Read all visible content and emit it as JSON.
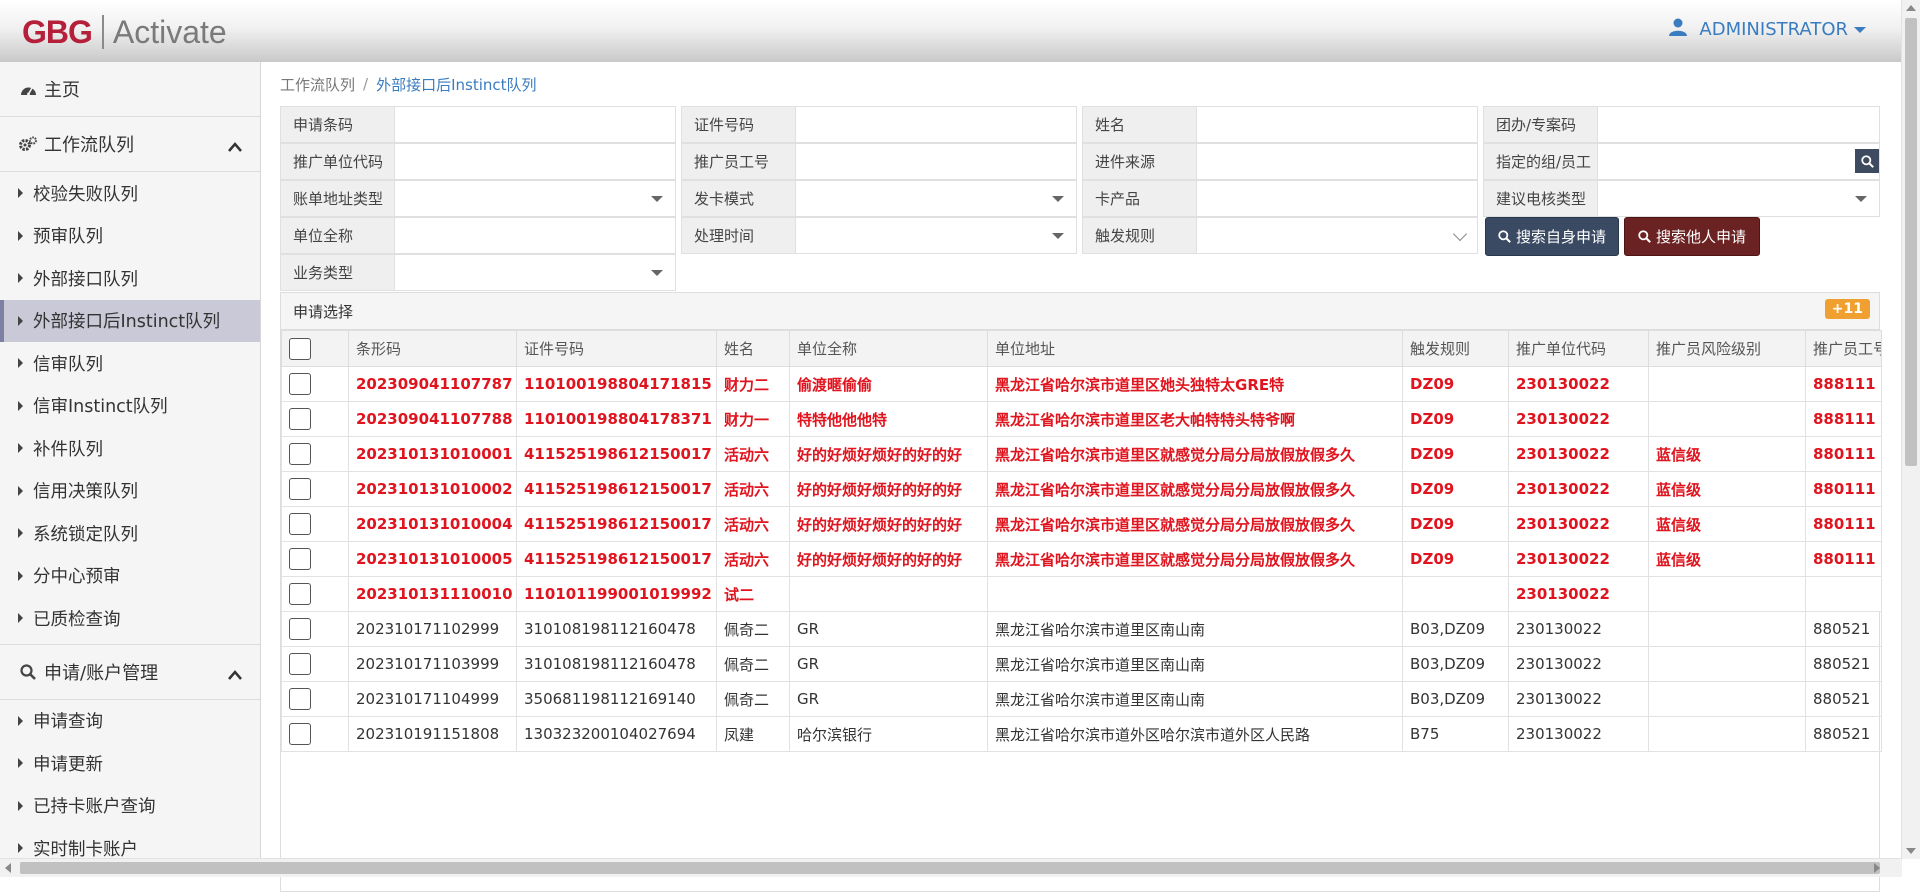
{
  "app": {
    "logo_left": "GBG",
    "logo_right": "Activate",
    "user": "ADMINISTRATOR"
  },
  "sidebar": {
    "home": "主页",
    "section1": "工作流队列",
    "items1": [
      "校验失败队列",
      "预审队列",
      "外部接口队列",
      "外部接口后Instinct队列",
      "信审队列",
      "信审Instinct队列",
      "补件队列",
      "信用决策队列",
      "系统锁定队列",
      "分中心预审",
      "已质检查询"
    ],
    "section2": "申请/账户管理",
    "items2": [
      "申请查询",
      "申请更新",
      "已持卡账户查询",
      "实时制卡账户"
    ]
  },
  "breadcrumb": {
    "parent": "工作流队列",
    "sep": "/",
    "current": "外部接口后Instinct队列"
  },
  "form": {
    "labels": [
      "申请条码",
      "证件号码",
      "姓名",
      "团办/专案码",
      "推广单位代码",
      "推广员工号",
      "进件来源",
      "指定的组/员工",
      "账单地址类型",
      "发卡模式",
      "卡产品",
      "建议电核类型",
      "单位全称",
      "处理时间",
      "触发规则",
      "业务类型"
    ],
    "btn_self": "搜索自身申请",
    "btn_other": "搜索他人申请"
  },
  "panel": {
    "title": "申请选择",
    "badge": "+11"
  },
  "table": {
    "headers": [
      "条形码",
      "证件号码",
      "姓名",
      "单位全称",
      "单位地址",
      "触发规则",
      "推广单位代码",
      "推广员风险级别",
      "推广员工号"
    ],
    "rows": [
      {
        "red": true,
        "cells": [
          "202309041107787",
          "110100198804171815",
          "财力二",
          "偷渡暱偷偷",
          "黑龙江省哈尔滨市道里区她头独特太GRE特",
          "DZ09",
          "230130022",
          "",
          "888111"
        ]
      },
      {
        "red": true,
        "cells": [
          "202309041107788",
          "110100198804178371",
          "财力一",
          "特特他他他特",
          "黑龙江省哈尔滨市道里区老大帕特特头特爷啊",
          "DZ09",
          "230130022",
          "",
          "888111"
        ]
      },
      {
        "red": true,
        "cells": [
          "202310131010001",
          "411525198612150017",
          "活动六",
          "好的好烦好烦好的好的好",
          "黑龙江省哈尔滨市道里区就感觉分局分局放假放假多久",
          "DZ09",
          "230130022",
          "蓝信级",
          "880111"
        ]
      },
      {
        "red": true,
        "cells": [
          "202310131010002",
          "411525198612150017",
          "活动六",
          "好的好烦好烦好的好的好",
          "黑龙江省哈尔滨市道里区就感觉分局分局放假放假多久",
          "DZ09",
          "230130022",
          "蓝信级",
          "880111"
        ]
      },
      {
        "red": true,
        "cells": [
          "202310131010004",
          "411525198612150017",
          "活动六",
          "好的好烦好烦好的好的好",
          "黑龙江省哈尔滨市道里区就感觉分局分局放假放假多久",
          "DZ09",
          "230130022",
          "蓝信级",
          "880111"
        ]
      },
      {
        "red": true,
        "cells": [
          "202310131010005",
          "411525198612150017",
          "活动六",
          "好的好烦好烦好的好的好",
          "黑龙江省哈尔滨市道里区就感觉分局分局放假放假多久",
          "DZ09",
          "230130022",
          "蓝信级",
          "880111"
        ]
      },
      {
        "red": true,
        "cells": [
          "202310131110010",
          "110101199001019992",
          "试二",
          "",
          "",
          "",
          "230130022",
          "",
          ""
        ]
      },
      {
        "red": false,
        "cells": [
          "202310171102999",
          "310108198112160478",
          "佩奇二",
          "GR",
          "黑龙江省哈尔滨市道里区南山南",
          "B03,DZ09",
          "230130022",
          "",
          "880521"
        ]
      },
      {
        "red": false,
        "cells": [
          "202310171103999",
          "310108198112160478",
          "佩奇二",
          "GR",
          "黑龙江省哈尔滨市道里区南山南",
          "B03,DZ09",
          "230130022",
          "",
          "880521"
        ]
      },
      {
        "red": false,
        "cells": [
          "202310171104999",
          "350681198112169140",
          "佩奇二",
          "GR",
          "黑龙江省哈尔滨市道里区南山南",
          "B03,DZ09",
          "230130022",
          "",
          "880521"
        ]
      },
      {
        "red": false,
        "cells": [
          "202310191151808",
          "130323200104027694",
          "凤建",
          "哈尔滨银行",
          "黑龙江省哈尔滨市道外区哈尔滨市道外区人民路",
          "B75",
          "230130022",
          "",
          "880521"
        ]
      }
    ]
  },
  "colors": {
    "accent": "#3a7cc0",
    "red_row": "#e0141e",
    "btn_self": "#3b4a63",
    "btn_other": "#6b2222",
    "badge": "#f0a030"
  }
}
